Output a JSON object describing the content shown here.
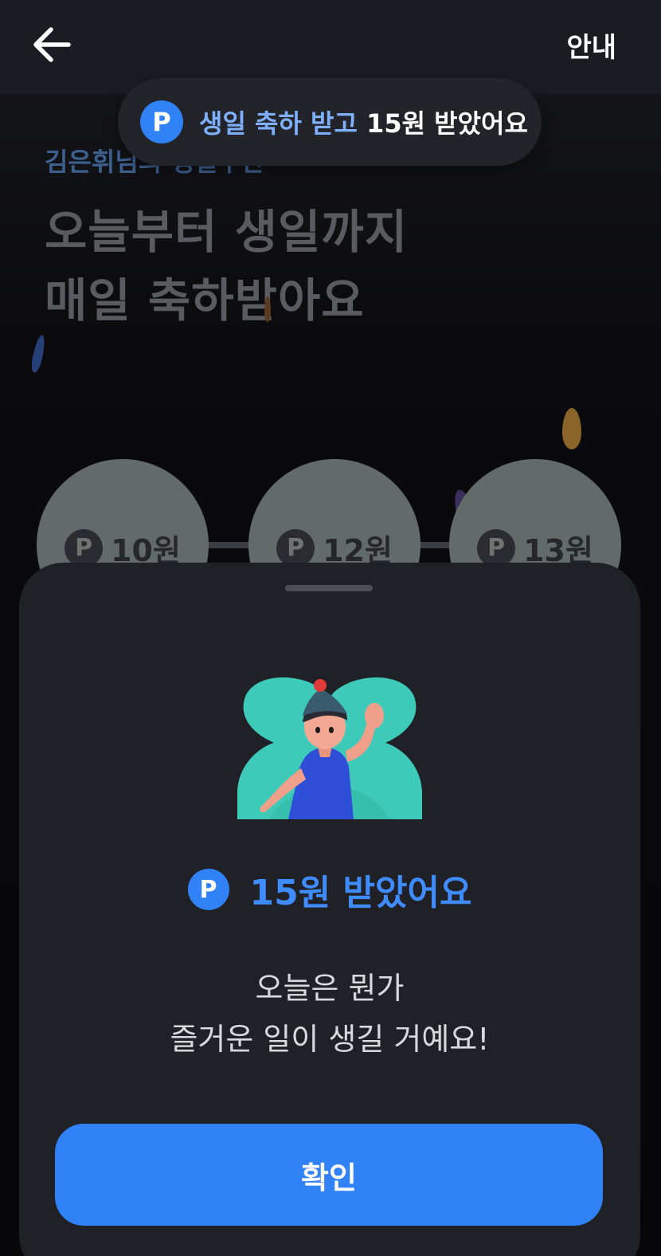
{
  "header": {
    "back_icon": "arrow-left-icon",
    "guide_label": "안내"
  },
  "toast": {
    "point_icon_letter": "P",
    "highlight_text": "생일 축하 받고",
    "rest_text": " 15원 받았어요"
  },
  "background_page": {
    "subtitle": "김은휘님의 생일주간",
    "title_line1": "오늘부터 생일까지",
    "title_line2": "매일 축하받아요",
    "days": [
      {
        "letter": "P",
        "amount": "10원"
      },
      {
        "letter": "P",
        "amount": "12원"
      },
      {
        "letter": "P",
        "amount": "13원"
      }
    ]
  },
  "sheet": {
    "reward_icon_letter": "P",
    "reward_text": "15원 받았어요",
    "message_line1": "오늘은 뭔가",
    "message_line2": "즐거운 일이 생길 거예요!",
    "confirm_label": "확인"
  },
  "colors": {
    "accent": "#3182f6",
    "accent_text": "#3f8cff",
    "sheet_bg": "#202127",
    "toast_bg": "#232429"
  }
}
